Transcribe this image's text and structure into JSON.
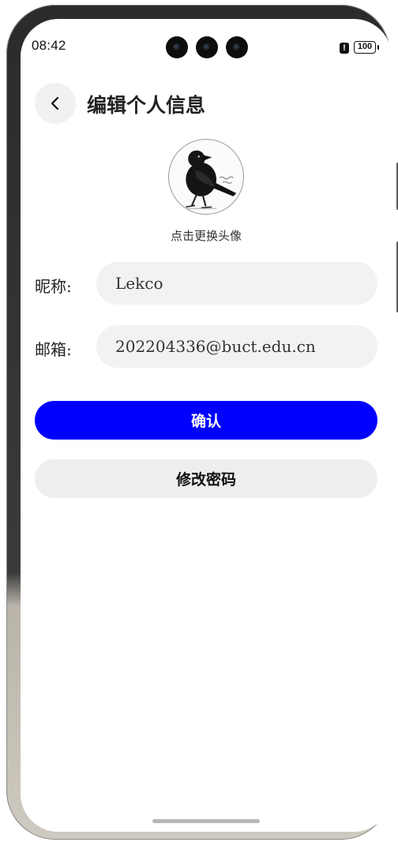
{
  "status_bar": {
    "time": "08:42",
    "alert_glyph": "!",
    "battery_level": "100",
    "icons": [
      "alert-icon",
      "battery-icon"
    ]
  },
  "header": {
    "back_icon": "chevron-left-icon",
    "title": "编辑个人信息"
  },
  "avatar": {
    "image": "crow-illustration",
    "caption": "点击更换头像"
  },
  "form": {
    "nickname_label": "昵称:",
    "nickname_value": "Lekco",
    "email_label": "邮箱:",
    "email_value": "202204336@buct.edu.cn"
  },
  "actions": {
    "confirm_label": "确认",
    "change_password_label": "修改密码"
  },
  "colors": {
    "primary": "#0000ff",
    "input_bg": "#f2f2f5",
    "secondary_button_bg": "#eeeeee"
  }
}
